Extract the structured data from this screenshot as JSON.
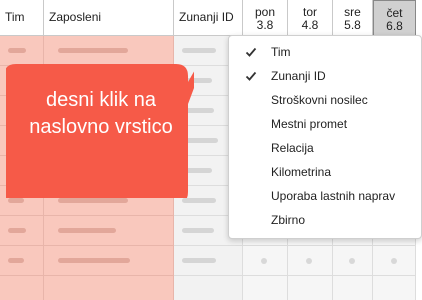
{
  "header": {
    "col_tim": "Tim",
    "col_zaposleni": "Zaposleni",
    "col_zunanji": "Zunanji ID",
    "days": [
      {
        "name": "pon",
        "date": "3.8"
      },
      {
        "name": "tor",
        "date": "4.8"
      },
      {
        "name": "sre",
        "date": "5.8"
      },
      {
        "name": "čet",
        "date": "6.8",
        "active": true
      }
    ]
  },
  "callout": {
    "text": "desni klik na naslovno vrstico",
    "color": "#f65a48"
  },
  "context_menu": {
    "items": [
      {
        "label": "Tim",
        "checked": true
      },
      {
        "label": "Zunanji ID",
        "checked": true
      },
      {
        "label": "Stroškovni nosilec",
        "checked": false
      },
      {
        "label": "Mestni promet",
        "checked": false
      },
      {
        "label": "Relacija",
        "checked": false
      },
      {
        "label": "Kilometrina",
        "checked": false
      },
      {
        "label": "Uporaba lastnih naprav",
        "checked": false
      },
      {
        "label": "Zbirno",
        "checked": false
      }
    ]
  },
  "colors": {
    "row_highlight": "#f9c8bd",
    "active_day": "#d0d0d0"
  }
}
